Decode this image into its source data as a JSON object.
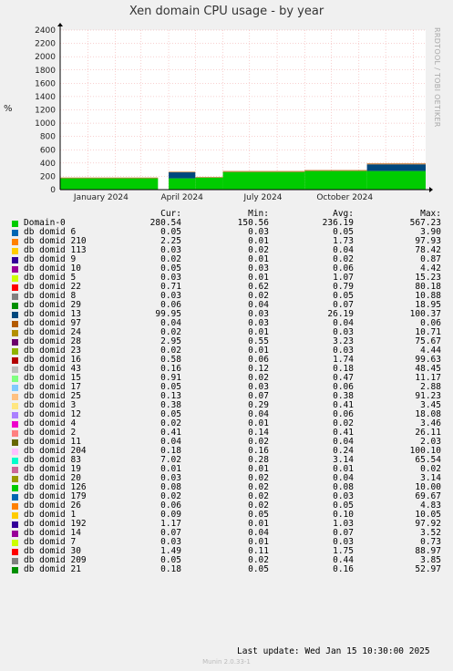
{
  "title": "Xen domain CPU usage - by year",
  "side_text": "RRDTOOL / TOBI OETIKER",
  "columns": [
    "Cur:",
    "Min:",
    "Avg:",
    "Max:"
  ],
  "last_update": "Last update:  Wed Jan 15 10:30:00 2025",
  "footer": "Munin 2.0.33-1",
  "chart_data": {
    "type": "area",
    "ylabel": "%",
    "ylim": [
      0,
      2400
    ],
    "yticks": [
      0,
      200,
      400,
      600,
      800,
      1000,
      1200,
      1400,
      1600,
      1800,
      2000,
      2200,
      2400
    ],
    "xlim": [
      "2023-12-01",
      "2025-01-15"
    ],
    "xticks": [
      "January 2024",
      "April 2024",
      "July 2024",
      "October 2024"
    ],
    "grid": true,
    "legend_position": "bottom",
    "segments": [
      {
        "start": "2023-12-01",
        "end": "2024-03-20",
        "domain0": 170,
        "domid13": 0,
        "other": 12
      },
      {
        "start": "2024-04-01",
        "end": "2024-05-01",
        "domain0": 170,
        "domid13": 90,
        "other": 10
      },
      {
        "start": "2024-05-01",
        "end": "2024-06-01",
        "domain0": 180,
        "domid13": 0,
        "other": 10
      },
      {
        "start": "2024-06-01",
        "end": "2024-09-01",
        "domain0": 265,
        "domid13": 0,
        "other": 15
      },
      {
        "start": "2024-09-01",
        "end": "2024-11-10",
        "domain0": 280,
        "domid13": 0,
        "other": 15
      },
      {
        "start": "2024-11-10",
        "end": "2025-01-15",
        "domain0": 280,
        "domid13": 100,
        "other": 15
      }
    ],
    "series": [
      {
        "name": "Domain-0",
        "color": "#00cc00",
        "cur": "280.54",
        "min": "150.56",
        "avg": "236.19",
        "max": "567.23"
      },
      {
        "name": "db domid 6",
        "color": "#0066b3",
        "cur": "0.05",
        "min": "0.03",
        "avg": "0.05",
        "max": "3.90"
      },
      {
        "name": "db domid 210",
        "color": "#ff8000",
        "cur": "2.25",
        "min": "0.01",
        "avg": "1.73",
        "max": "97.93"
      },
      {
        "name": "db domid 113",
        "color": "#ffcc00",
        "cur": "0.03",
        "min": "0.02",
        "avg": "0.04",
        "max": "78.42"
      },
      {
        "name": "db domid 9",
        "color": "#330099",
        "cur": "0.02",
        "min": "0.01",
        "avg": "0.02",
        "max": "0.87"
      },
      {
        "name": "db domid 10",
        "color": "#990099",
        "cur": "0.05",
        "min": "0.03",
        "avg": "0.06",
        "max": "4.42"
      },
      {
        "name": "db domid 5",
        "color": "#ccff00",
        "cur": "0.03",
        "min": "0.01",
        "avg": "1.07",
        "max": "15.23"
      },
      {
        "name": "db domid 22",
        "color": "#ff0000",
        "cur": "0.71",
        "min": "0.62",
        "avg": "0.79",
        "max": "80.18"
      },
      {
        "name": "db domid 8",
        "color": "#808080",
        "cur": "0.03",
        "min": "0.02",
        "avg": "0.05",
        "max": "10.88"
      },
      {
        "name": "db domid 29",
        "color": "#008f00",
        "cur": "0.06",
        "min": "0.04",
        "avg": "0.07",
        "max": "18.95"
      },
      {
        "name": "db domid 13",
        "color": "#00487d",
        "cur": "99.95",
        "min": "0.03",
        "avg": "26.19",
        "max": "100.37"
      },
      {
        "name": "db domid 97",
        "color": "#b35a00",
        "cur": "0.04",
        "min": "0.03",
        "avg": "0.04",
        "max": "0.06"
      },
      {
        "name": "db domid 24",
        "color": "#b38f00",
        "cur": "0.02",
        "min": "0.01",
        "avg": "0.03",
        "max": "10.71"
      },
      {
        "name": "db domid 28",
        "color": "#6b006b",
        "cur": "2.95",
        "min": "0.55",
        "avg": "3.23",
        "max": "75.67"
      },
      {
        "name": "db domid 23",
        "color": "#8fb300",
        "cur": "0.02",
        "min": "0.01",
        "avg": "0.03",
        "max": "4.44"
      },
      {
        "name": "db domid 16",
        "color": "#b30000",
        "cur": "0.58",
        "min": "0.06",
        "avg": "1.74",
        "max": "99.63"
      },
      {
        "name": "db domid 43",
        "color": "#bebebe",
        "cur": "0.16",
        "min": "0.12",
        "avg": "0.18",
        "max": "48.45"
      },
      {
        "name": "db domid 15",
        "color": "#80ff80",
        "cur": "0.91",
        "min": "0.02",
        "avg": "0.47",
        "max": "11.17"
      },
      {
        "name": "db domid 17",
        "color": "#80c9ff",
        "cur": "0.05",
        "min": "0.03",
        "avg": "0.06",
        "max": "2.88"
      },
      {
        "name": "db domid 25",
        "color": "#ffc080",
        "cur": "0.13",
        "min": "0.07",
        "avg": "0.38",
        "max": "91.23"
      },
      {
        "name": "db domid 3",
        "color": "#ffe680",
        "cur": "0.38",
        "min": "0.29",
        "avg": "0.41",
        "max": "3.45"
      },
      {
        "name": "db domid 12",
        "color": "#aa80ff",
        "cur": "0.05",
        "min": "0.04",
        "avg": "0.06",
        "max": "18.08"
      },
      {
        "name": "db domid 4",
        "color": "#ee00cc",
        "cur": "0.02",
        "min": "0.01",
        "avg": "0.02",
        "max": "3.46"
      },
      {
        "name": "db domid 2",
        "color": "#ff8080",
        "cur": "0.41",
        "min": "0.14",
        "avg": "0.41",
        "max": "26.11"
      },
      {
        "name": "db domid 11",
        "color": "#666600",
        "cur": "0.04",
        "min": "0.02",
        "avg": "0.04",
        "max": "2.03"
      },
      {
        "name": "db domid 204",
        "color": "#ffbfff",
        "cur": "0.18",
        "min": "0.16",
        "avg": "0.24",
        "max": "100.10"
      },
      {
        "name": "db domid 83",
        "color": "#00ffcc",
        "cur": "7.02",
        "min": "0.28",
        "avg": "3.14",
        "max": "65.54"
      },
      {
        "name": "db domid 19",
        "color": "#cc6699",
        "cur": "0.01",
        "min": "0.01",
        "avg": "0.01",
        "max": "0.02"
      },
      {
        "name": "db domid 20",
        "color": "#999900",
        "cur": "0.03",
        "min": "0.02",
        "avg": "0.04",
        "max": "3.14"
      },
      {
        "name": "db domid 126",
        "color": "#00cc00",
        "cur": "0.08",
        "min": "0.02",
        "avg": "0.08",
        "max": "10.00"
      },
      {
        "name": "db domid 179",
        "color": "#0066b3",
        "cur": "0.02",
        "min": "0.02",
        "avg": "0.03",
        "max": "69.67"
      },
      {
        "name": "db domid 26",
        "color": "#ff8000",
        "cur": "0.06",
        "min": "0.02",
        "avg": "0.05",
        "max": "4.83"
      },
      {
        "name": "db domid 1",
        "color": "#ffcc00",
        "cur": "0.09",
        "min": "0.05",
        "avg": "0.10",
        "max": "10.05"
      },
      {
        "name": "db domid 192",
        "color": "#330099",
        "cur": "1.17",
        "min": "0.01",
        "avg": "1.03",
        "max": "97.92"
      },
      {
        "name": "db domid 14",
        "color": "#990099",
        "cur": "0.07",
        "min": "0.04",
        "avg": "0.07",
        "max": "3.52"
      },
      {
        "name": "db domid 7",
        "color": "#ccff00",
        "cur": "0.03",
        "min": "0.01",
        "avg": "0.03",
        "max": "0.73"
      },
      {
        "name": "db domid 30",
        "color": "#ff0000",
        "cur": "1.49",
        "min": "0.11",
        "avg": "1.75",
        "max": "88.97"
      },
      {
        "name": "db domid 209",
        "color": "#808080",
        "cur": "0.05",
        "min": "0.02",
        "avg": "0.44",
        "max": "3.85"
      },
      {
        "name": "db domid 21",
        "color": "#008f00",
        "cur": "0.18",
        "min": "0.05",
        "avg": "0.16",
        "max": "52.97"
      }
    ]
  }
}
